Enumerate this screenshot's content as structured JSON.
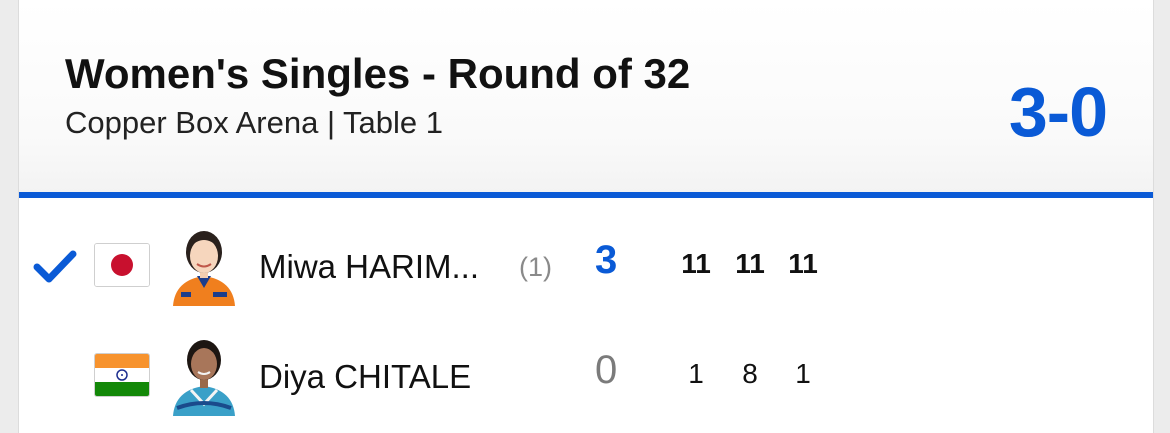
{
  "header": {
    "title": "Women's Singles - Round of 32",
    "subtitle": "Copper Box Arena | Table 1",
    "match_score": "3-0"
  },
  "players": [
    {
      "name": "Miwa HARIM...",
      "seed": "(1)",
      "games_won": "3",
      "winner": true,
      "country_flag": "japan-flag-icon",
      "set_scores": [
        "11",
        "11",
        "11"
      ]
    },
    {
      "name": "Diya CHITALE",
      "seed": "",
      "games_won": "0",
      "winner": false,
      "country_flag": "india-flag-icon",
      "set_scores": [
        "1",
        "8",
        "1"
      ]
    }
  ],
  "colors": {
    "accent": "#0a5ad6",
    "loser_games": "#7b7b7b",
    "seed": "#8a8a8a"
  }
}
